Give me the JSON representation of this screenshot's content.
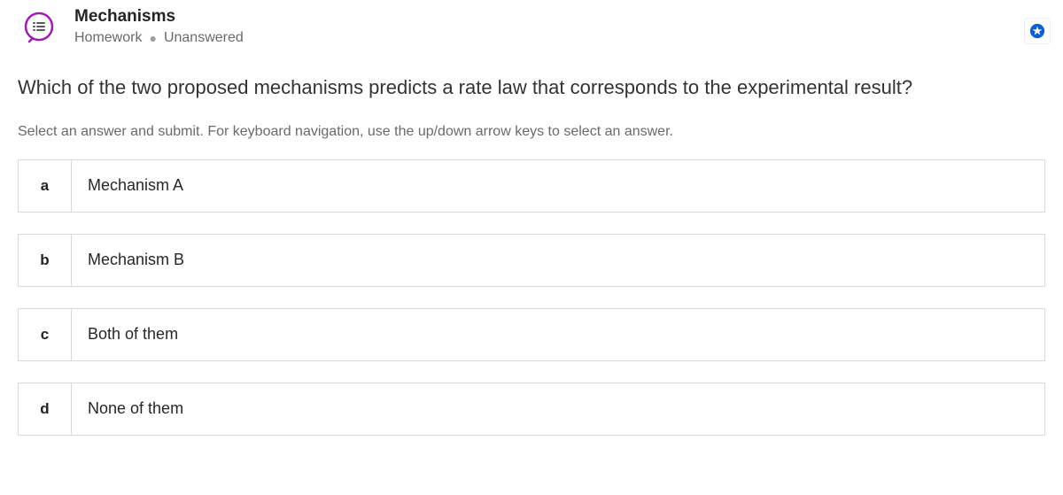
{
  "header": {
    "title": "Mechanisms",
    "meta": {
      "category": "Homework",
      "status": "Unanswered"
    }
  },
  "question": "Which of the two proposed mechanisms predicts a rate law that corresponds to the experimental result?",
  "instruction": "Select an answer and submit. For keyboard navigation, use the up/down arrow keys to select an answer.",
  "options": [
    {
      "letter": "a",
      "text": "Mechanism A"
    },
    {
      "letter": "b",
      "text": "Mechanism B"
    },
    {
      "letter": "c",
      "text": "Both of them"
    },
    {
      "letter": "d",
      "text": "None of them"
    }
  ],
  "colors": {
    "accent": "#a31bb5",
    "favorite": "#0a5ed7"
  }
}
